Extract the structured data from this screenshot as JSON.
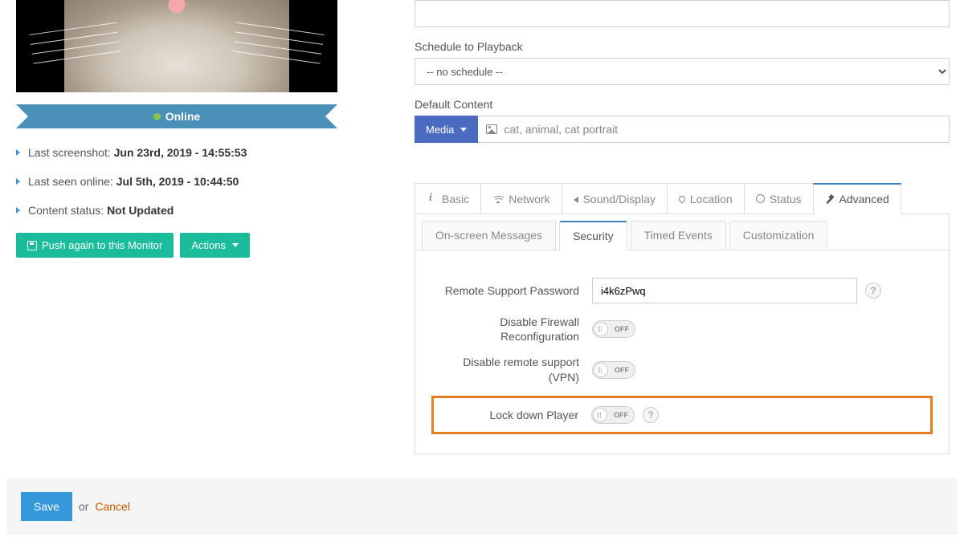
{
  "status": {
    "online_label": "Online"
  },
  "meta": {
    "last_screenshot_label": "Last screenshot:",
    "last_screenshot_value": "Jun 23rd, 2019 - 14:55:53",
    "last_seen_label": "Last seen online:",
    "last_seen_value": "Jul 5th, 2019 - 10:44:50",
    "content_status_label": "Content status:",
    "content_status_value": "Not Updated"
  },
  "buttons": {
    "push_again": "Push again to this Monitor",
    "actions": "Actions"
  },
  "right": {
    "schedule_label": "Schedule to Playback",
    "schedule_value": "-- no schedule --",
    "default_content_label": "Default Content",
    "media_button": "Media",
    "media_value": "cat, animal, cat portrait"
  },
  "tabs1": {
    "basic": "Basic",
    "network": "Network",
    "sound_display": "Sound/Display",
    "location": "Location",
    "status": "Status",
    "advanced": "Advanced"
  },
  "tabs2": {
    "onscreen": "On-screen Messages",
    "security": "Security",
    "timed": "Timed Events",
    "customization": "Customization"
  },
  "security": {
    "remote_support_password_label": "Remote Support Password",
    "remote_support_password_value": "i4k6zPwq",
    "disable_firewall_label": "Disable Firewall Reconfiguration",
    "disable_vpn_label": "Disable remote support (VPN)",
    "lockdown_label": "Lock down Player",
    "toggle_off": "OFF"
  },
  "footer": {
    "save": "Save",
    "or": "or",
    "cancel": "Cancel"
  }
}
